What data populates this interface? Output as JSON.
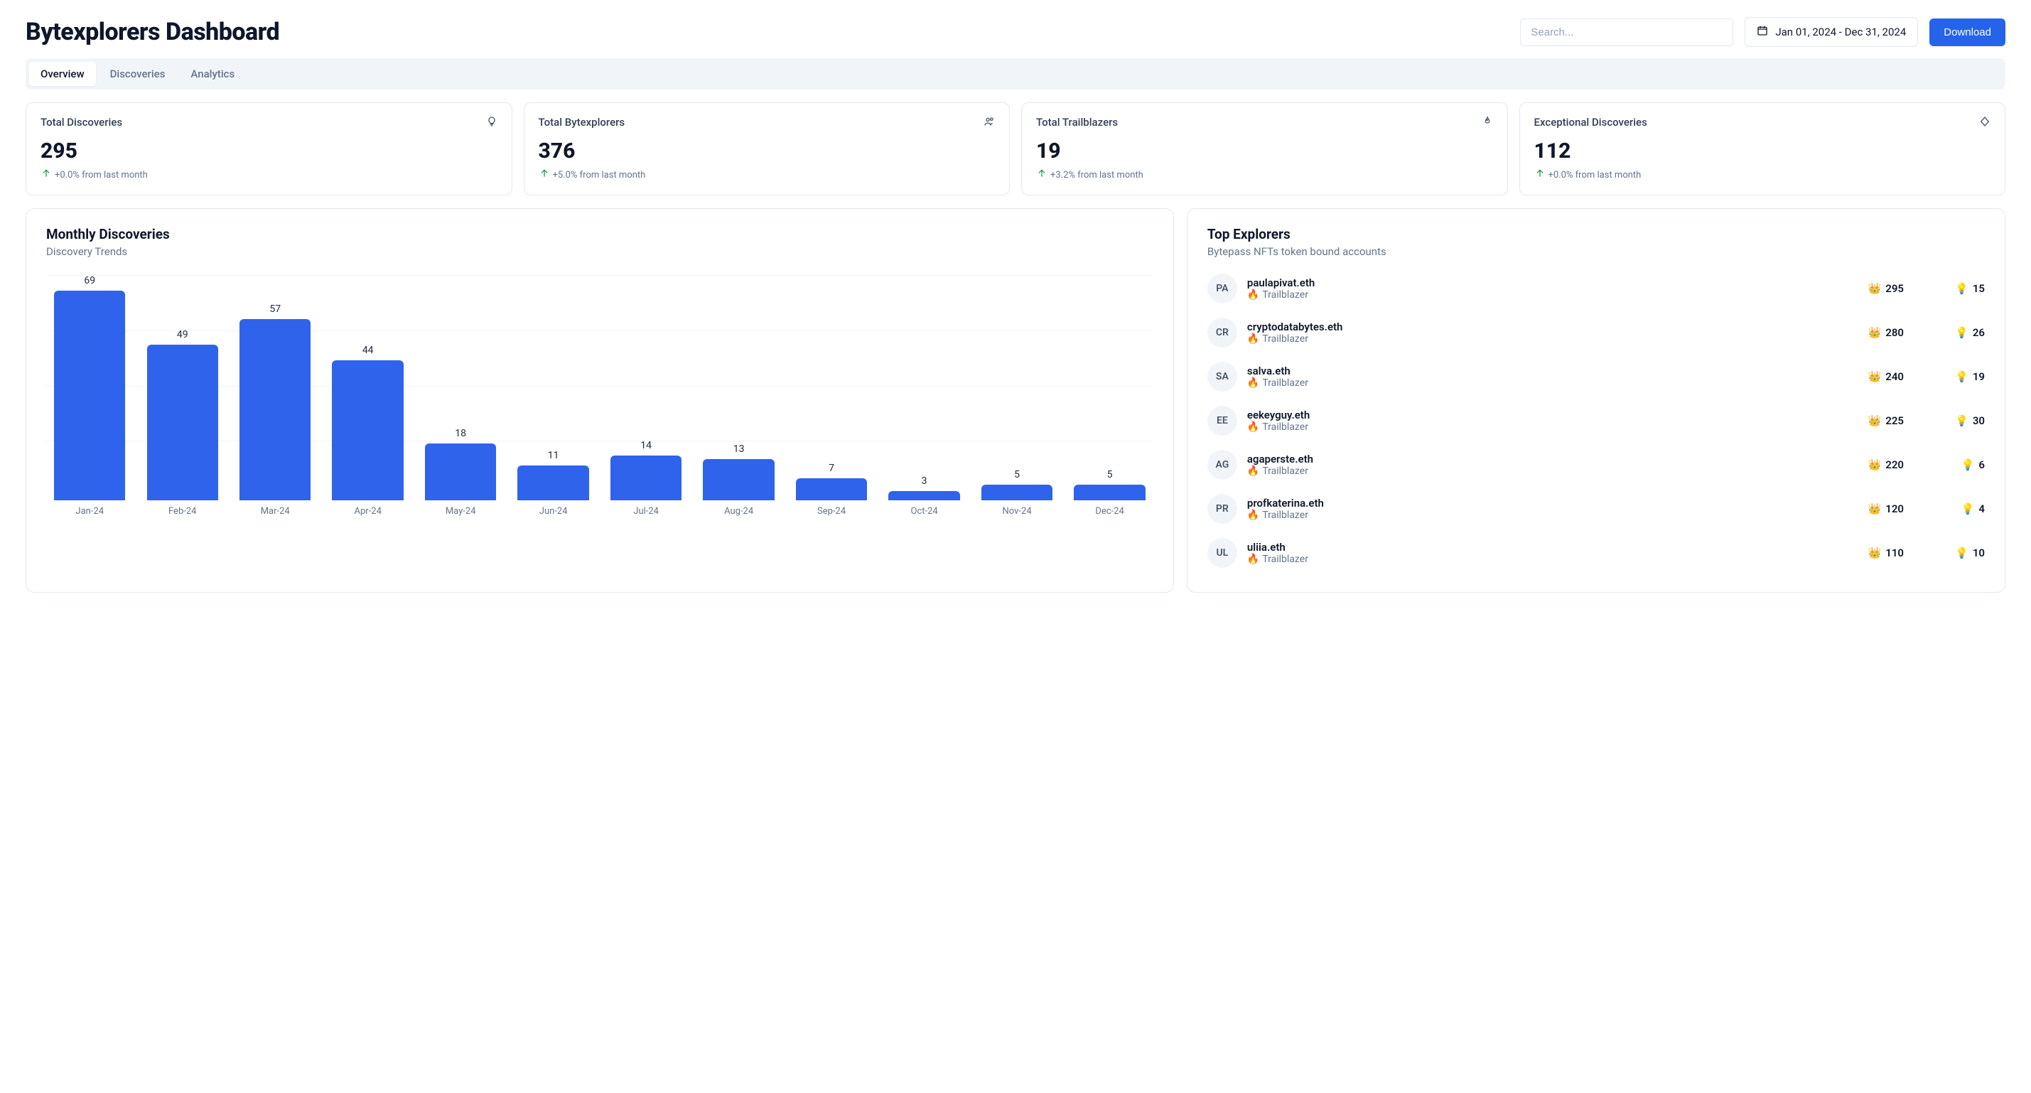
{
  "header": {
    "title": "Bytexplorers Dashboard",
    "search_placeholder": "Search...",
    "date_range": "Jan 01, 2024 - Dec 31, 2024",
    "download_label": "Download"
  },
  "tabs": {
    "overview": "Overview",
    "discoveries": "Discoveries",
    "analytics": "Analytics"
  },
  "stats": [
    {
      "label": "Total Discoveries",
      "value": "295",
      "delta": "+0.0% from last month",
      "icon": "lightbulb"
    },
    {
      "label": "Total Bytexplorers",
      "value": "376",
      "delta": "+5.0% from last month",
      "icon": "users"
    },
    {
      "label": "Total Trailblazers",
      "value": "19",
      "delta": "+3.2% from last month",
      "icon": "flame"
    },
    {
      "label": "Exceptional Discoveries",
      "value": "112",
      "delta": "+0.0% from last month",
      "icon": "diamond"
    }
  ],
  "chart_panel": {
    "title": "Monthly Discoveries",
    "subtitle": "Discovery Trends"
  },
  "chart_data": {
    "type": "bar",
    "categories": [
      "Jan-24",
      "Feb-24",
      "Mar-24",
      "Apr-24",
      "May-24",
      "Jun-24",
      "Jul-24",
      "Aug-24",
      "Sep-24",
      "Oct-24",
      "Nov-24",
      "Dec-24"
    ],
    "values": [
      69,
      49,
      57,
      44,
      18,
      11,
      14,
      13,
      7,
      3,
      5,
      5
    ],
    "title": "Monthly Discoveries",
    "xlabel": "",
    "ylabel": "",
    "ylim": [
      0,
      70
    ]
  },
  "explorers_panel": {
    "title": "Top Explorers",
    "subtitle": "Bytepass NFTs token bound accounts",
    "role_label": "Trailblazer"
  },
  "explorers": [
    {
      "initials": "PA",
      "name": "paulapivat.eth",
      "crowns": 295,
      "bulbs": 15
    },
    {
      "initials": "CR",
      "name": "cryptodatabytes.eth",
      "crowns": 280,
      "bulbs": 26
    },
    {
      "initials": "SA",
      "name": "salva.eth",
      "crowns": 240,
      "bulbs": 19
    },
    {
      "initials": "EE",
      "name": "eekeyguy.eth",
      "crowns": 225,
      "bulbs": 30
    },
    {
      "initials": "AG",
      "name": "agaperste.eth",
      "crowns": 220,
      "bulbs": 6
    },
    {
      "initials": "PR",
      "name": "profkaterina.eth",
      "crowns": 120,
      "bulbs": 4
    },
    {
      "initials": "UL",
      "name": "uliia.eth",
      "crowns": 110,
      "bulbs": 10
    }
  ],
  "icons": {
    "crown": "👑",
    "bulb": "💡",
    "fire": "🔥"
  }
}
